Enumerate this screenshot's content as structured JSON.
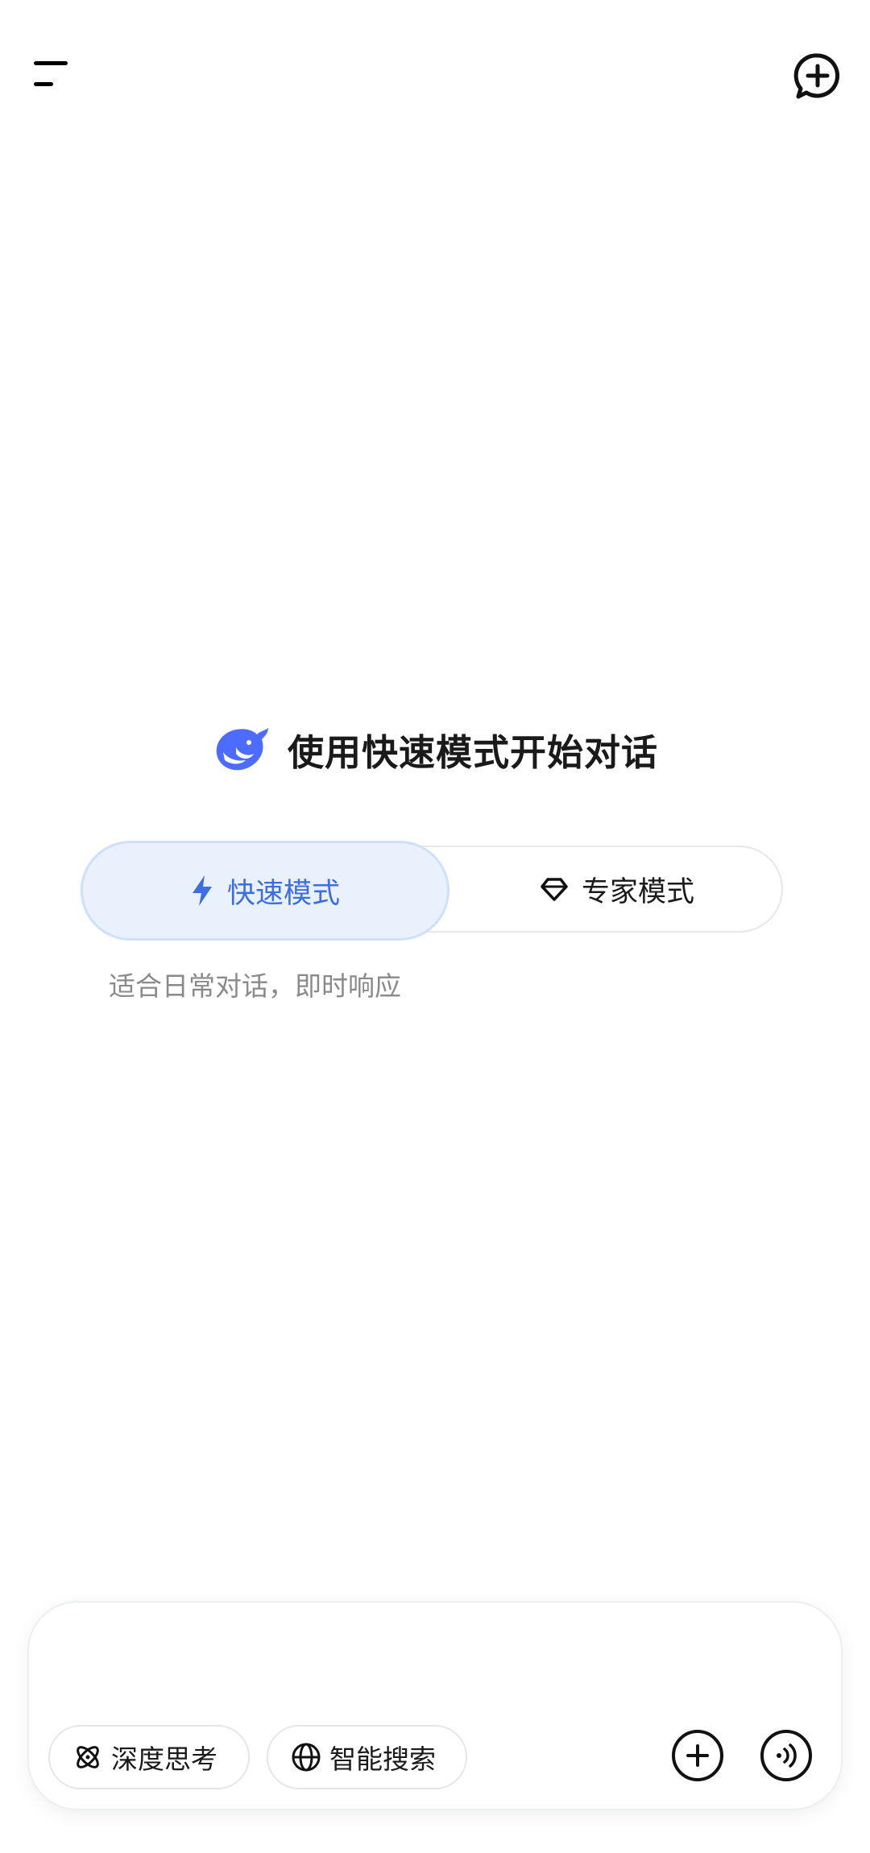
{
  "header": {
    "menu_icon": "menu-icon",
    "new_chat_icon": "new-chat-icon"
  },
  "welcome": {
    "logo_icon": "whale-logo-icon",
    "title": "使用快速模式开始对话"
  },
  "modes": {
    "selected": "fast",
    "fast": {
      "icon": "lightning-icon",
      "label": "快速模式"
    },
    "expert": {
      "icon": "diamond-icon",
      "label": "专家模式"
    },
    "description": "适合日常对话，即时响应"
  },
  "composer": {
    "input_value": "",
    "deep_think": {
      "icon": "atom-icon",
      "label": "深度思考"
    },
    "smart_search": {
      "icon": "globe-icon",
      "label": "智能搜索"
    },
    "attach_icon": "plus-circle-icon",
    "voice_icon": "voice-wave-icon"
  },
  "colors": {
    "accent": "#3c6ee0",
    "accent_bg": "#e9f1fd",
    "muted_text": "#8a8a8a"
  }
}
